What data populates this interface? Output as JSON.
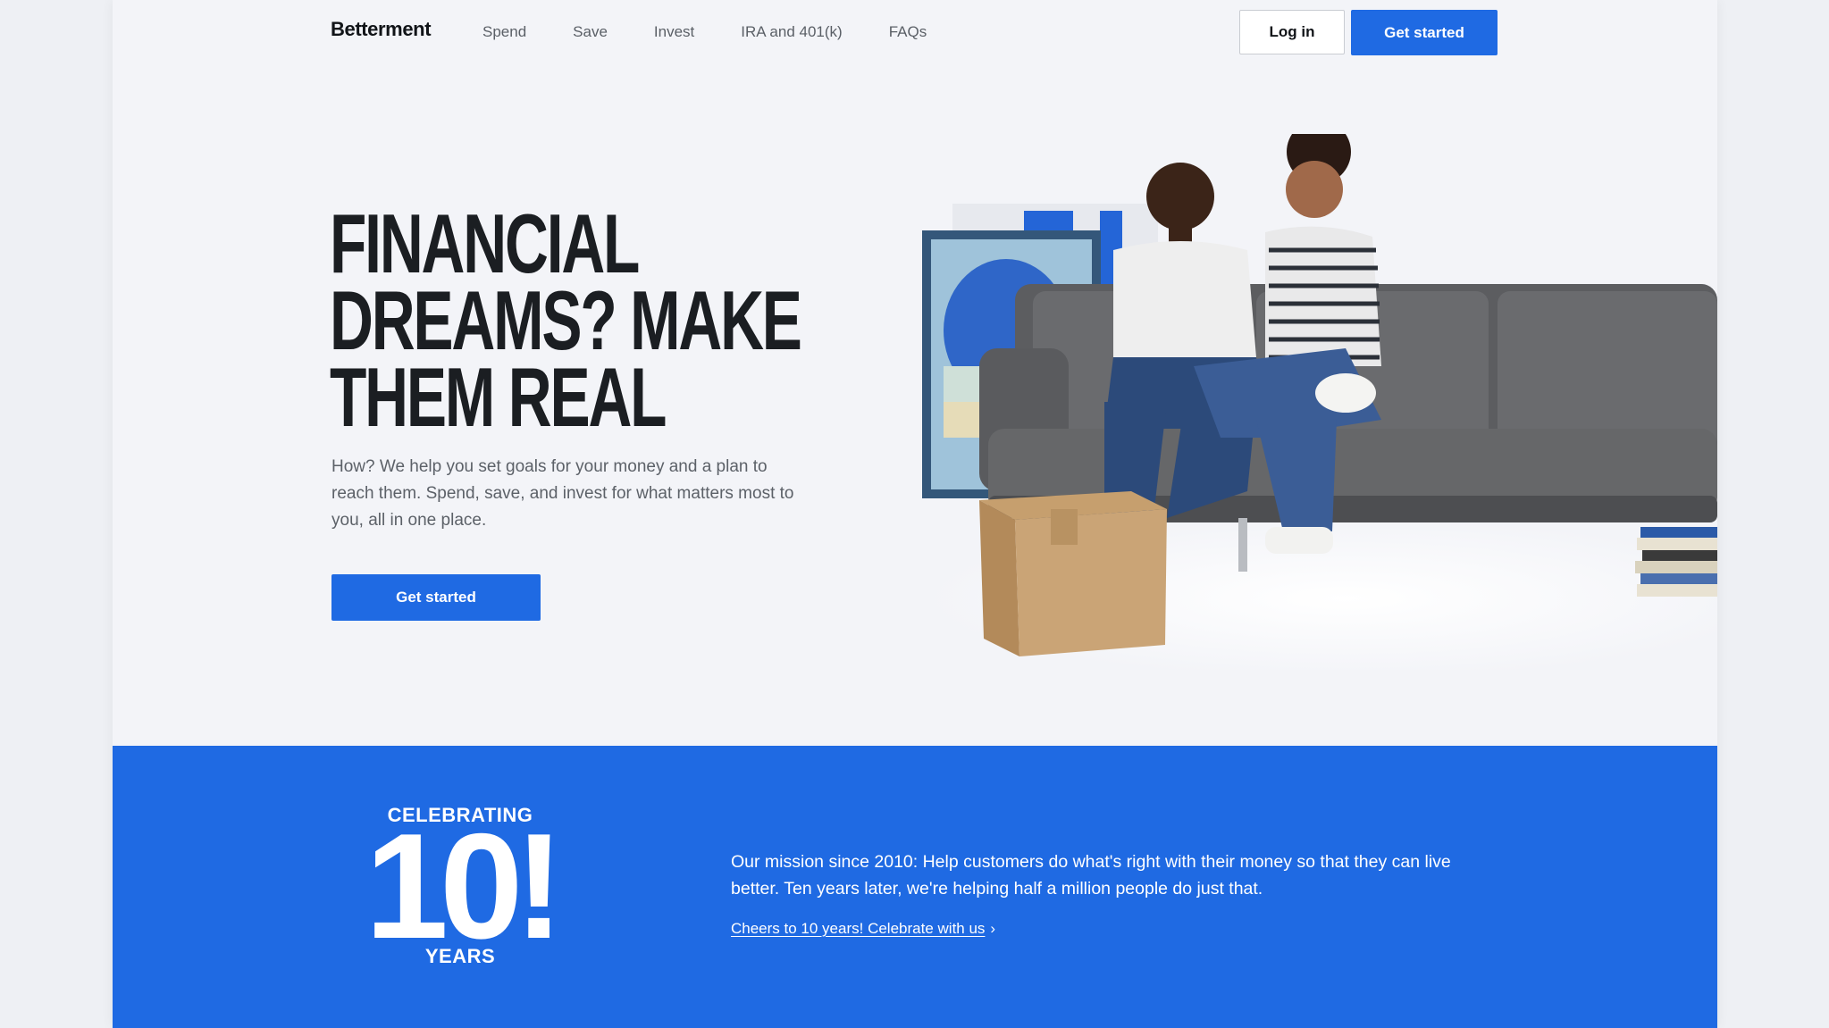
{
  "brand": {
    "name": "Betterment",
    "accent": "#1f6ae3",
    "background": "#f3f4f8"
  },
  "nav": {
    "links": [
      "Spend",
      "Save",
      "Invest",
      "IRA and 401(k)",
      "FAQs"
    ],
    "login_label": "Log in",
    "cta_label": "Get started"
  },
  "hero": {
    "title_lines": [
      "FINANCIAL",
      "DREAMS? MAKE",
      "THEM REAL"
    ],
    "body": "How? We help you set goals for your money and a plan to reach them. Spend, save, and invest for what matters most to you, all in one place.",
    "cta_label": "Get started",
    "image_icon": "couple-on-sofa-illustration"
  },
  "anniversary": {
    "badge_top": "CELEBRATING",
    "badge_number": "10!",
    "badge_bottom": "YEARS",
    "mission": "Our mission since 2010: Help customers do what's right with their money so that they can live better. Ten years later, we're helping half a million people do just that.",
    "link_label": "Cheers to 10 years! Celebrate with us",
    "link_icon": "chevron-right-icon"
  }
}
